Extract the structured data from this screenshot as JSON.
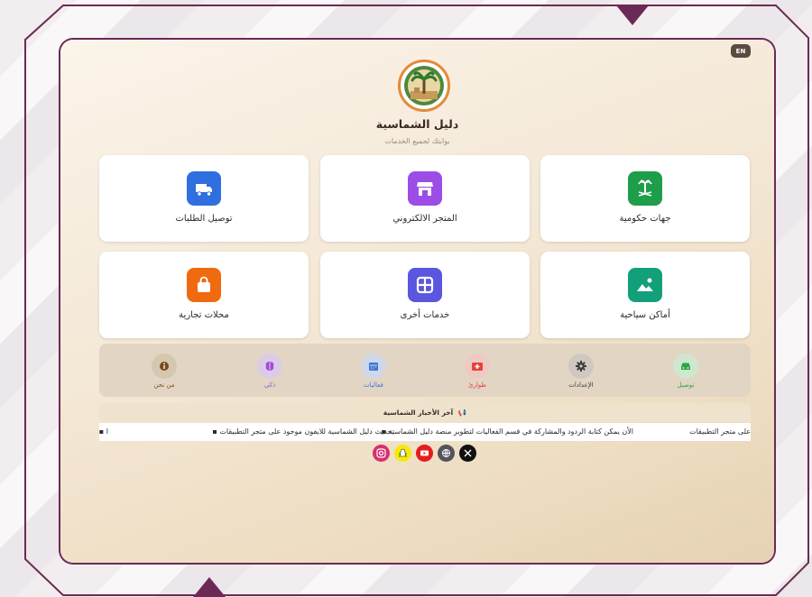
{
  "colors": {
    "frame": "#6b2a55",
    "background": "#f2eef0",
    "accent_orange": "#e48a3a"
  },
  "header": {
    "lang_button": "EN",
    "title": "دليل الشماسية",
    "subtitle": "بوابتك لجميع الخدمات",
    "logo_icon": "palm-tree-logo"
  },
  "services": [
    {
      "label": "جهات حكومية",
      "icon": "saudi-emblem-icon",
      "color": "#1e9e4a"
    },
    {
      "label": "المتجر الالكتروني",
      "icon": "store-icon",
      "color": "#9b4de6"
    },
    {
      "label": "توصيل الطلبات",
      "icon": "delivery-truck-icon",
      "color": "#2f6fe0"
    },
    {
      "label": "أماكن سياحية",
      "icon": "landscape-icon",
      "color": "#12a07a"
    },
    {
      "label": "خدمات أخرى",
      "icon": "grid-icon",
      "color": "#5a56e0"
    },
    {
      "label": "محلات تجارية",
      "icon": "shopping-bag-icon",
      "color": "#f06a10"
    }
  ],
  "quick_bar": [
    {
      "label": "توصيل",
      "icon": "car-icon",
      "color": "#27a745",
      "bg": "#cfe7cf"
    },
    {
      "label": "الإعدادات",
      "icon": "gear-icon",
      "color": "#3a3a3a",
      "bg": "#d0c8c0"
    },
    {
      "label": "طوارئ",
      "icon": "first-aid-icon",
      "color": "#e0443c",
      "bg": "#efc9c3"
    },
    {
      "label": "فعاليات",
      "icon": "calendar-icon",
      "color": "#3c78d8",
      "bg": "#cfd7e8"
    },
    {
      "label": "ذكي",
      "icon": "brain-icon",
      "color": "#a44cd8",
      "bg": "#dccbe8"
    },
    {
      "label": "من نحن",
      "icon": "info-icon",
      "color": "#8a5a2a",
      "bg": "#d6c7b0"
    }
  ],
  "news": {
    "header": "آخر الأخبار الشماسية",
    "items": [
      "على متجر التطبيقات",
      "الأن يمكن كتابة الردود والمشاركة في قسم الفعاليات لتطوير منصة دليل الشماسية",
      "تحديث دليل الشماسية للايفون موجود على متجر التطبيقات",
      "ا"
    ]
  },
  "social": [
    {
      "icon": "instagram-icon",
      "color": "#d6306f"
    },
    {
      "icon": "snapchat-icon",
      "color": "#f6e90b"
    },
    {
      "icon": "youtube-icon",
      "color": "#e51d1d"
    },
    {
      "icon": "globe-icon",
      "color": "#55545c"
    },
    {
      "icon": "x-icon",
      "color": "#111111"
    }
  ]
}
